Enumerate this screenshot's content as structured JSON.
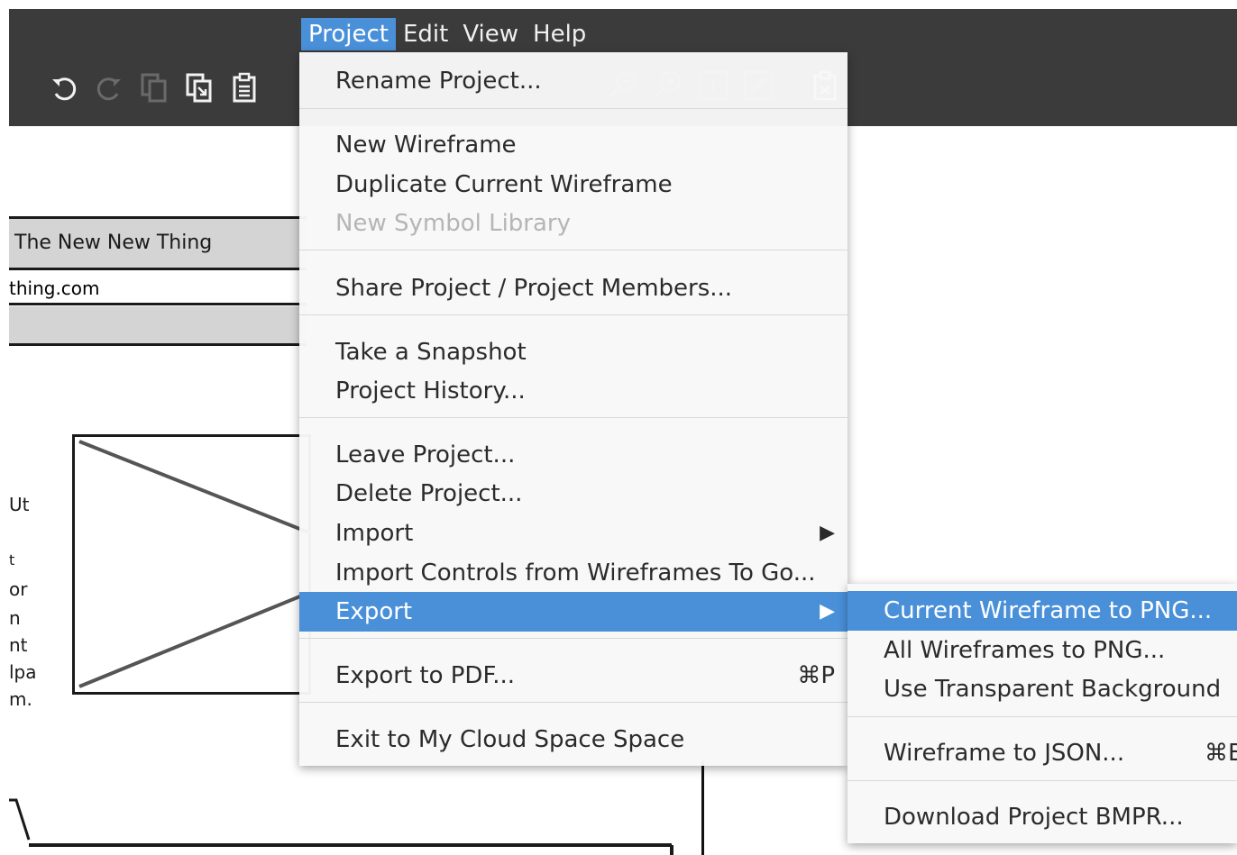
{
  "menubar": {
    "items": [
      {
        "label": "Project",
        "active": true
      },
      {
        "label": "Edit",
        "active": false
      },
      {
        "label": "View",
        "active": false
      },
      {
        "label": "Help",
        "active": false
      }
    ]
  },
  "toolbar": {
    "left_icons": [
      "undo-icon",
      "redo-icon",
      "copy-icon",
      "duplicate-icon",
      "paste-icon"
    ],
    "right_icons": [
      "zoom-out-icon",
      "zoom-in-icon",
      "actual-size-icon",
      "fit-icon",
      "clipboard-icon"
    ]
  },
  "canvas": {
    "title": "The New New Thing",
    "url": "thing.com",
    "side_text": [
      "Ut",
      "t",
      "or",
      "n",
      "nt",
      "lpa",
      "m."
    ]
  },
  "project_menu": {
    "rename": "Rename Project...",
    "new_wireframe": "New Wireframe",
    "duplicate": "Duplicate Current Wireframe",
    "new_symbol_library": "New Symbol Library",
    "share": "Share Project / Project Members...",
    "snapshot": "Take a Snapshot",
    "history": "Project History...",
    "leave": "Leave Project...",
    "delete": "Delete Project...",
    "import": "Import",
    "import_controls": "Import Controls from Wireframes To Go...",
    "export": "Export",
    "export_pdf": "Export to PDF...",
    "export_pdf_shortcut": "⌘P",
    "exit": "Exit to My Cloud Space Space",
    "submenu_arrow": "▶"
  },
  "export_submenu": {
    "current_png": "Current Wireframe to PNG...",
    "all_png": "All Wireframes to PNG...",
    "transparent": "Use Transparent Background",
    "json": "Wireframe to JSON...",
    "json_shortcut": "⌘E",
    "bmpr": "Download Project BMPR..."
  },
  "colors": {
    "topbar": "#3b3b3b",
    "highlight": "#4a90d9",
    "menu_bg": "#f8f8f8"
  }
}
